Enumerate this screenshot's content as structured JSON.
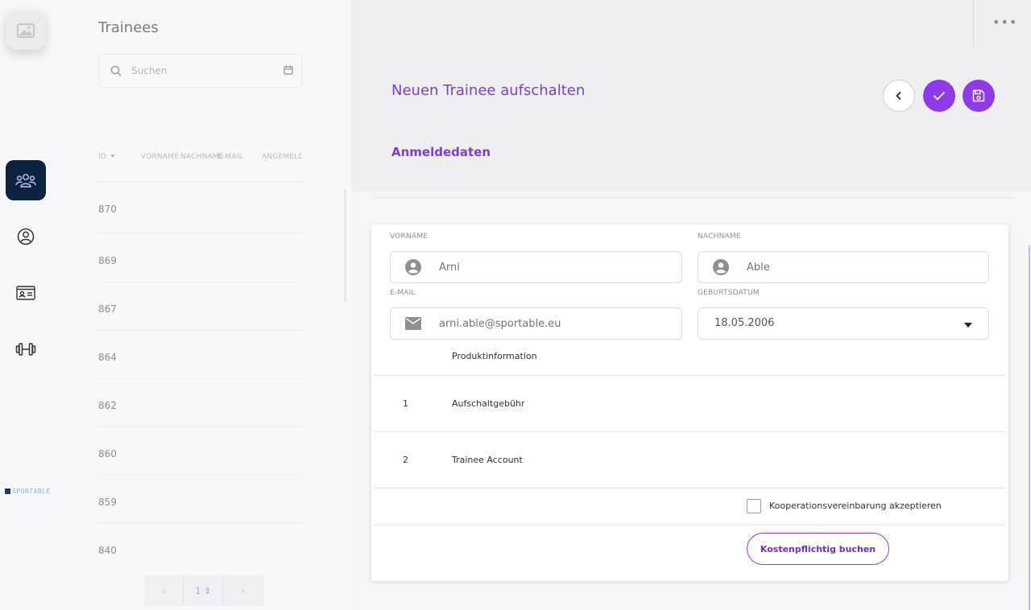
{
  "sidebar": {
    "nav": [
      {
        "icon": "users-icon",
        "active": true
      },
      {
        "icon": "user-circle-icon",
        "active": false
      },
      {
        "icon": "id-card-icon",
        "active": false
      },
      {
        "icon": "dumbbell-icon",
        "active": false
      }
    ],
    "brand_text": "SPORTABLE"
  },
  "list": {
    "title": "Trainees",
    "search_placeholder": "Suchen",
    "columns": [
      "ID",
      "VORNAME",
      "NACHNAME",
      "E-MAIL",
      "ANGEMELDET"
    ],
    "rows": [
      "870",
      "869",
      "867",
      "864",
      "862",
      "860",
      "859",
      "840"
    ],
    "pager": {
      "prev": "‹",
      "current": "1 ⇕",
      "next": "›"
    }
  },
  "header": {
    "more": "•••",
    "page_title": "Neuen Trainee aufschalten",
    "section_title": "Anmeldedaten"
  },
  "form": {
    "firstname_label": "VORNAME",
    "firstname_placeholder": "Arni",
    "lastname_label": "NACHNAME",
    "lastname_placeholder": "Able",
    "email_label": "E-MAIL",
    "email_placeholder": "arni.able@sportable.eu",
    "birthdate_label": "GEBURTSDATUM",
    "birthdate_value": "18.05.2006"
  },
  "products": {
    "header": "Produktinformation",
    "rows": [
      {
        "num": "1",
        "name": "Aufschaltgebühr"
      },
      {
        "num": "2",
        "name": "Trainee Account"
      }
    ]
  },
  "agreement": {
    "label": "Kooperationsvereinbarung akzeptieren",
    "checked": false
  },
  "book_button": "Kostenpflichtig buchen",
  "colors": {
    "accent": "#8e3ae8",
    "title_purple": "#7c3fd1",
    "nav_active": "#0d2140"
  }
}
